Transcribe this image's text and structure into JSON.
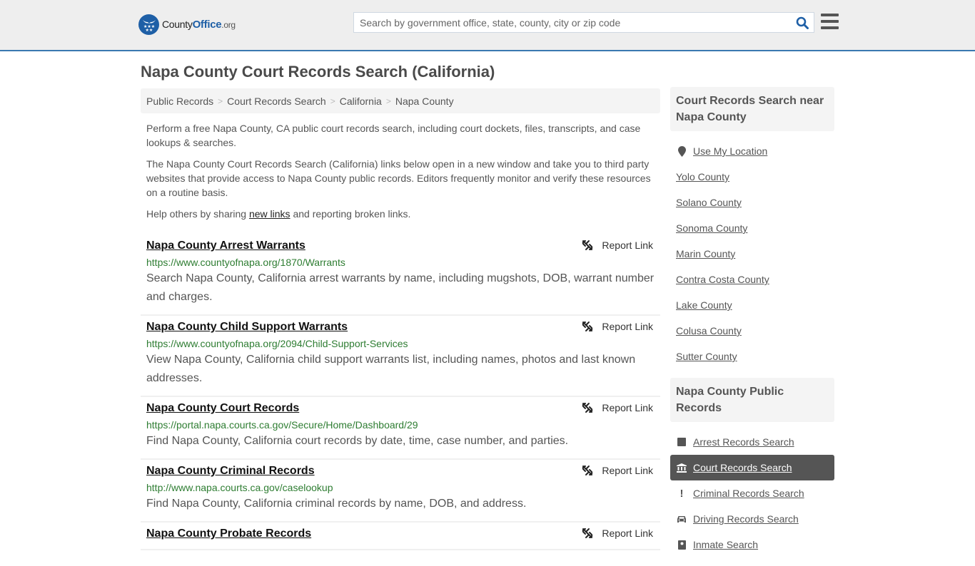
{
  "header": {
    "logo": {
      "name": "County",
      "brand": "Office",
      "tld": ".org"
    },
    "search_placeholder": "Search by government office, state, county, city or zip code",
    "search_value": ""
  },
  "page_title": "Napa County Court Records Search (California)",
  "breadcrumb": [
    {
      "label": "Public Records"
    },
    {
      "label": "Court Records Search"
    },
    {
      "label": "California"
    },
    {
      "label": "Napa County"
    }
  ],
  "intro": {
    "p1": "Perform a free Napa County, CA public court records search, including court dockets, files, transcripts, and case lookups & searches.",
    "p2": "The Napa County Court Records Search (California) links below open in a new window and take you to third party websites that provide access to Napa County public records. Editors frequently monitor and verify these resources on a routine basis.",
    "p3_before": "Help others by sharing ",
    "p3_link": "new links",
    "p3_after": " and reporting broken links."
  },
  "report_label": "Report Link",
  "results": [
    {
      "title": "Napa County Arrest Warrants",
      "url": "https://www.countyofnapa.org/1870/Warrants",
      "desc": "Search Napa County, California arrest warrants by name, including mugshots, DOB, warrant number and charges."
    },
    {
      "title": "Napa County Child Support Warrants",
      "url": "https://www.countyofnapa.org/2094/Child-Support-Services",
      "desc": "View Napa County, California child support warrants list, including names, photos and last known addresses."
    },
    {
      "title": "Napa County Court Records",
      "url": "https://portal.napa.courts.ca.gov/Secure/Home/Dashboard/29",
      "desc": "Find Napa County, California court records by date, time, case number, and parties."
    },
    {
      "title": "Napa County Criminal Records",
      "url": "http://www.napa.courts.ca.gov/caselookup",
      "desc": "Find Napa County, California criminal records by name, DOB, and address."
    },
    {
      "title": "Napa County Probate Records",
      "url": "",
      "desc": ""
    }
  ],
  "sidebar": {
    "nearby_heading": "Court Records Search near Napa County",
    "use_location": "Use My Location",
    "nearby": [
      "Yolo County",
      "Solano County",
      "Sonoma County",
      "Marin County",
      "Contra Costa County",
      "Lake County",
      "Colusa County",
      "Sutter County"
    ],
    "public_heading": "Napa County Public Records",
    "public_records": [
      {
        "label": "Arrest Records Search",
        "icon": "square-icon",
        "active": false
      },
      {
        "label": "Court Records Search",
        "icon": "courthouse-icon",
        "active": true
      },
      {
        "label": "Criminal Records Search",
        "icon": "exclamation-icon",
        "active": false
      },
      {
        "label": "Driving Records Search",
        "icon": "car-icon",
        "active": false
      },
      {
        "label": "Inmate Search",
        "icon": "inmate-icon",
        "active": false
      }
    ]
  }
}
